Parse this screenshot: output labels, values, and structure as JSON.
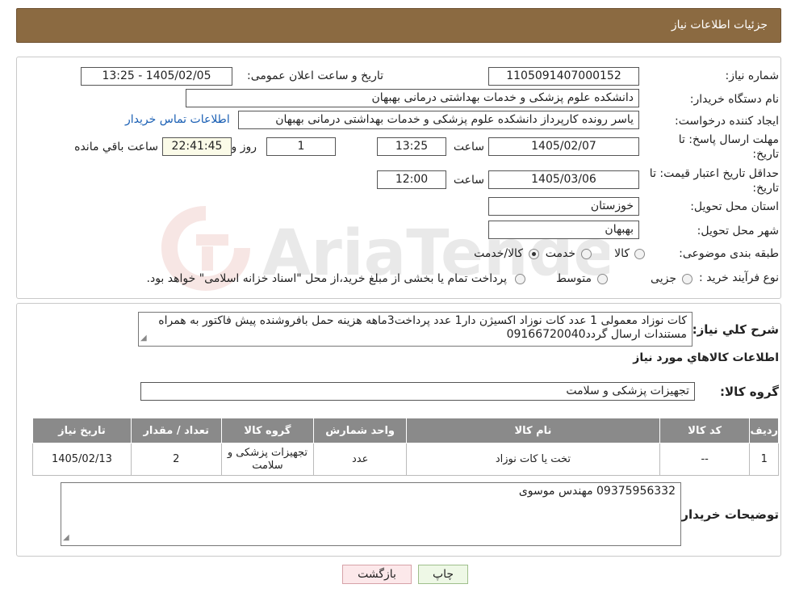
{
  "header": {
    "title": "جزئیات اطلاعات نیاز"
  },
  "fields": {
    "need_number_label": "شماره نیاز:",
    "need_number": "1105091407000152",
    "announce_label": "تاریخ و ساعت اعلان عمومی:",
    "announce_value": "1405/02/05 - 13:25",
    "buyer_org_label": "نام دستگاه خریدار:",
    "buyer_org": "دانشکده علوم پزشکی و خدمات بهداشتی  درمانی بهبهان",
    "requester_label": "ایجاد کننده درخواست:",
    "requester": "یاسر رونده کارپرداز دانشکده علوم پزشکی و خدمات بهداشتی  درمانی بهبهان",
    "contact_link": "اطلاعات تماس خریدار",
    "deadline_label_1": "مهلت ارسال پاسخ: تا",
    "deadline_label_2": "تاریخ:",
    "deadline_date": "1405/02/07",
    "time_label": "ساعت",
    "deadline_time": "13:25",
    "days_value": "1",
    "days_label": "روز و",
    "remaining_time": "22:41:45",
    "remaining_label": "ساعت باقي مانده",
    "validity_label_1": "حداقل تاریخ اعتبار قیمت: تا",
    "validity_label_2": "تاریخ:",
    "validity_date": "1405/03/06",
    "validity_time": "12:00",
    "province_label": "استان محل تحویل:",
    "province": "خوزستان",
    "city_label": "شهر محل تحویل:",
    "city": "بهبهان",
    "category_label": "طبقه بندی موضوعی:",
    "category_options": [
      "کالا",
      "خدمت",
      "کالا/خدمت"
    ],
    "process_label": "نوع فرآیند خرید :",
    "process_options": [
      "جزیی",
      "متوسط"
    ],
    "process_note": "پرداخت تمام یا بخشی از مبلغ خرید،از محل \"اسناد خزانه اسلامی\" خواهد بود."
  },
  "description": {
    "label": "شرح کلي نياز:",
    "text": "کات نوزاد معمولی 1 عدد کات نوزاد اکسیژن دار1 عدد پرداخت3ماهه هزینه حمل بافروشنده پیش فاکتور به همراه مستندات ارسال گردد09166720040"
  },
  "goods": {
    "section_title": "اطلاعات کالاهاي مورد نياز",
    "group_label": "گروه کالا:",
    "group_value": "تجهیزات پزشکی و سلامت",
    "columns": [
      "رديف",
      "کد کالا",
      "نام کالا",
      "واحد شمارش",
      "گروه کالا",
      "تعداد / مقدار",
      "تاریخ نیاز"
    ],
    "rows": [
      [
        "1",
        "--",
        "تخت یا کات نوزاد",
        "عدد",
        "تجهیزات پزشکی و سلامت",
        "2",
        "1405/02/13"
      ]
    ]
  },
  "buyer_notes": {
    "label": "توضیحات خریدار:",
    "text": "09375956332 مهندس موسوی"
  },
  "buttons": {
    "print": "چاپ",
    "back": "بازگشت"
  },
  "watermark": {
    "text": "AriaTender.neT"
  }
}
